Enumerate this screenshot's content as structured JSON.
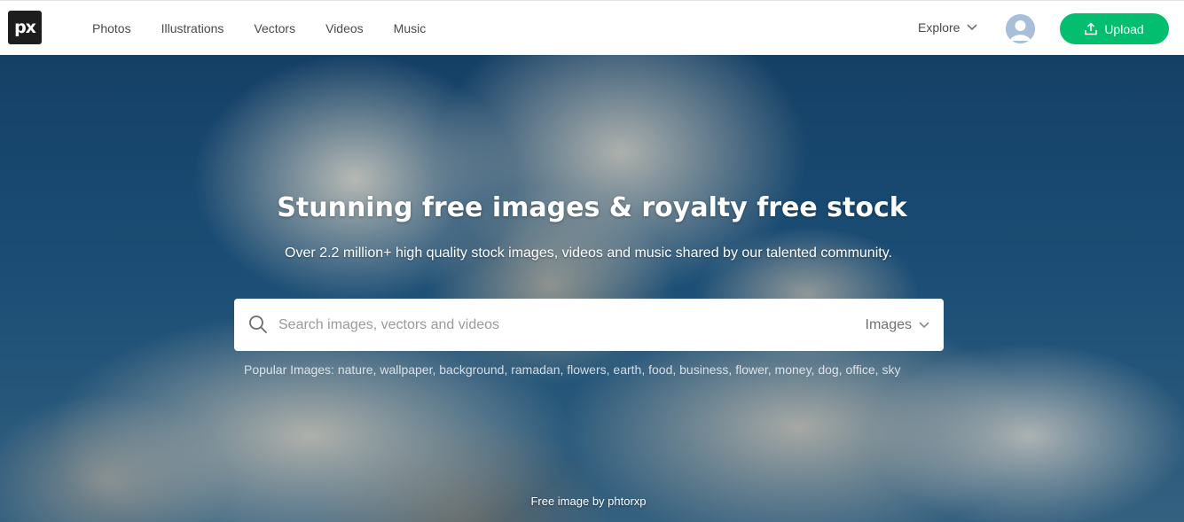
{
  "brand": {
    "logo_text": "px"
  },
  "nav": {
    "items": [
      "Photos",
      "Illustrations",
      "Vectors",
      "Videos",
      "Music"
    ],
    "explore_label": "Explore",
    "upload_label": "Upload",
    "accent_color": "#02be6e"
  },
  "hero": {
    "title": "Stunning free images & royalty free stock",
    "subtitle": "Over 2.2 million+ high quality stock images, videos and music shared by our talented community.",
    "search": {
      "placeholder": "Search images, vectors and videos",
      "value": "",
      "type_selected": "Images"
    },
    "popular_label": "Popular Images:",
    "popular_tags": [
      "nature",
      "wallpaper",
      "background",
      "ramadan",
      "flowers",
      "earth",
      "food",
      "business",
      "flower",
      "money",
      "dog",
      "office",
      "sky"
    ],
    "credit": "Free image by phtorxp"
  },
  "icons": {
    "search": "search-icon",
    "explore_chevron": "chevron-down-icon",
    "type_chevron": "chevron-down-icon",
    "upload": "upload-icon",
    "avatar": "user-avatar-icon"
  }
}
